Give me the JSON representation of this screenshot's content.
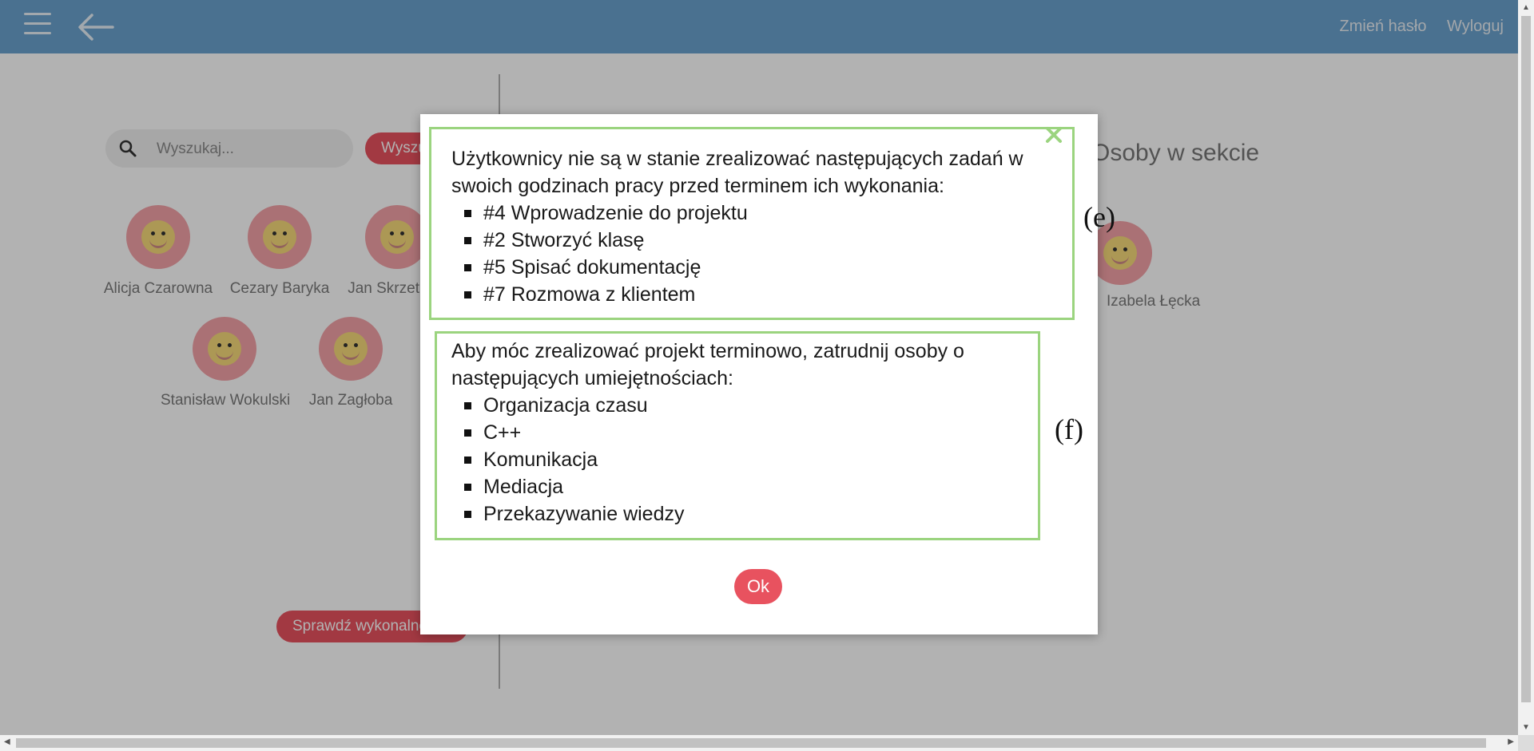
{
  "header": {
    "change_password": "Zmień hasło",
    "logout": "Wyloguj",
    "bar_color": "#6aa3cf"
  },
  "left_panel": {
    "search_placeholder": "Wyszukaj...",
    "search_button": "Wyszukaj",
    "users": [
      {
        "name": "Alicja Czarowna"
      },
      {
        "name": "Cezary Baryka"
      },
      {
        "name": "Jan Skrzetuski"
      },
      {
        "name": "Stanisław Wokulski"
      },
      {
        "name": "Jan Zagłoba"
      }
    ],
    "check_button": "Sprawdź wykonalność"
  },
  "right_panel": {
    "title": "Osoby w sekcie",
    "user_name": "Izabela Łęcka"
  },
  "modal": {
    "box_e": {
      "intro": "Użytkownicy nie są w stanie zrealizować następujących zadań w swoich godzinach pracy przed terminem ich wykonania:",
      "items": [
        "#4 Wprowadzenie do projektu",
        "#2 Stworzyć klasę",
        "#5 Spisać dokumentację",
        "#7 Rozmowa z klientem"
      ],
      "label": "(e)"
    },
    "box_f": {
      "intro": "Aby móc zrealizować projekt terminowo, zatrudnij osoby o następujących umiejętnościach:",
      "items": [
        "Organizacja czasu",
        "C++",
        "Komunikacja",
        "Mediacja",
        "Przekazywanie wiedzy"
      ],
      "label": "(f)"
    },
    "ok_button": "Ok",
    "border_color": "#9bd47f",
    "accent_color": "#e8525f"
  }
}
